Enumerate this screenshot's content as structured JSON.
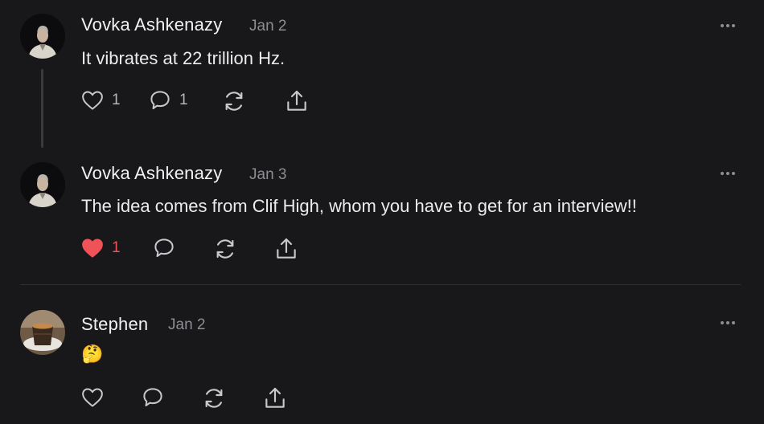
{
  "comments": [
    {
      "author": "Vovka Ashkenazy",
      "date": "Jan 2",
      "text": "It vibrates at 22 trillion Hz.",
      "likes": "1",
      "replies": "1",
      "liked": false
    },
    {
      "author": "Vovka Ashkenazy",
      "date": "Jan 3",
      "text": "The idea comes from Clif High, whom you have to get for an interview!!",
      "likes": "1",
      "liked": true
    },
    {
      "author": "Stephen",
      "date": "Jan 2",
      "text": "🤔",
      "liked": false
    }
  ],
  "icons": {
    "like": "heart-icon",
    "reply": "speech-bubble-icon",
    "restack": "restack-icon",
    "share": "share-icon",
    "more": "more-dots-icon"
  },
  "colors": {
    "background": "#18181b",
    "liked": "#ef5257",
    "muted": "#8d8d92"
  }
}
